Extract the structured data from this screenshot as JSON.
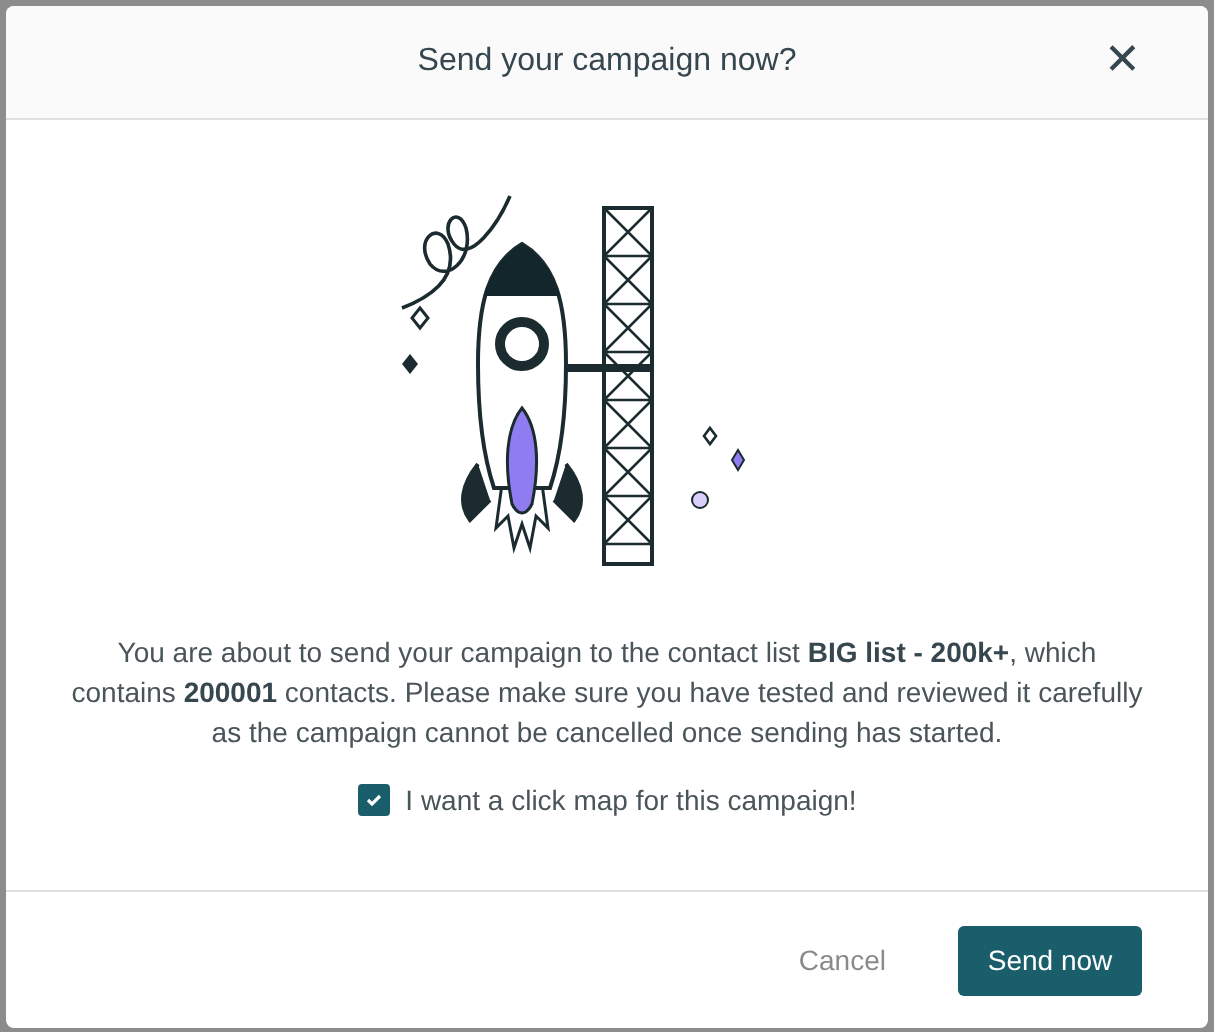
{
  "dialog": {
    "title": "Send your campaign now?",
    "close_icon": "✕",
    "message": "You are about to send your campaign to the contact list **BIG list - 200k+**, which contains **200001** contacts. Please make sure you have tested and reviewed it carefully as the campaign cannot be cancelled once sending has started.",
    "checkbox": {
      "label": "I want a click map for this campaign!",
      "checked": true
    },
    "buttons": [
      {
        "label": "Cancel",
        "kind": "text"
      },
      {
        "label": "Send now",
        "kind": "primary"
      }
    ]
  }
}
